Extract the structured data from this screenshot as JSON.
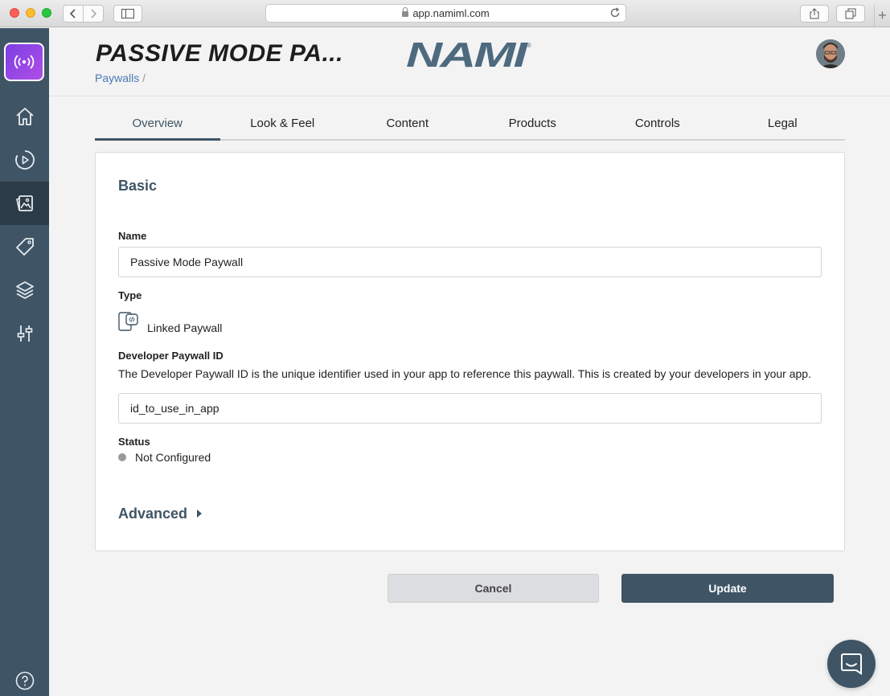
{
  "browser": {
    "url": "app.namiml.com"
  },
  "sidebar": {
    "items": [
      {
        "icon": "home-icon"
      },
      {
        "icon": "campaigns-icon"
      },
      {
        "icon": "paywalls-icon",
        "active": true
      },
      {
        "icon": "tag-icon"
      },
      {
        "icon": "layers-icon"
      },
      {
        "icon": "sliders-icon"
      }
    ],
    "help_icon": "help-icon"
  },
  "header": {
    "title": "PASSIVE MODE PA...",
    "breadcrumb_link": "Paywalls",
    "breadcrumb_sep": "/",
    "brand": "NAMI",
    "brand_mark": "®"
  },
  "tabs": [
    {
      "label": "Overview",
      "active": true
    },
    {
      "label": "Look & Feel"
    },
    {
      "label": "Content"
    },
    {
      "label": "Products"
    },
    {
      "label": "Controls"
    },
    {
      "label": "Legal"
    }
  ],
  "form": {
    "section_title": "Basic",
    "name_label": "Name",
    "name_value": "Passive Mode Paywall",
    "type_label": "Type",
    "type_value": "Linked Paywall",
    "dev_id_label": "Developer Paywall ID",
    "dev_id_description": "The Developer Paywall ID is the unique identifier used in your app to reference this paywall. This is created by your developers in your app.",
    "dev_id_value": "id_to_use_in_app",
    "status_label": "Status",
    "status_value": "Not Configured",
    "advanced_label": "Advanced"
  },
  "actions": {
    "cancel_label": "Cancel",
    "update_label": "Update"
  },
  "colors": {
    "primary": "#3f5566",
    "link": "#4a7ab5",
    "status_dot": "#999999"
  }
}
